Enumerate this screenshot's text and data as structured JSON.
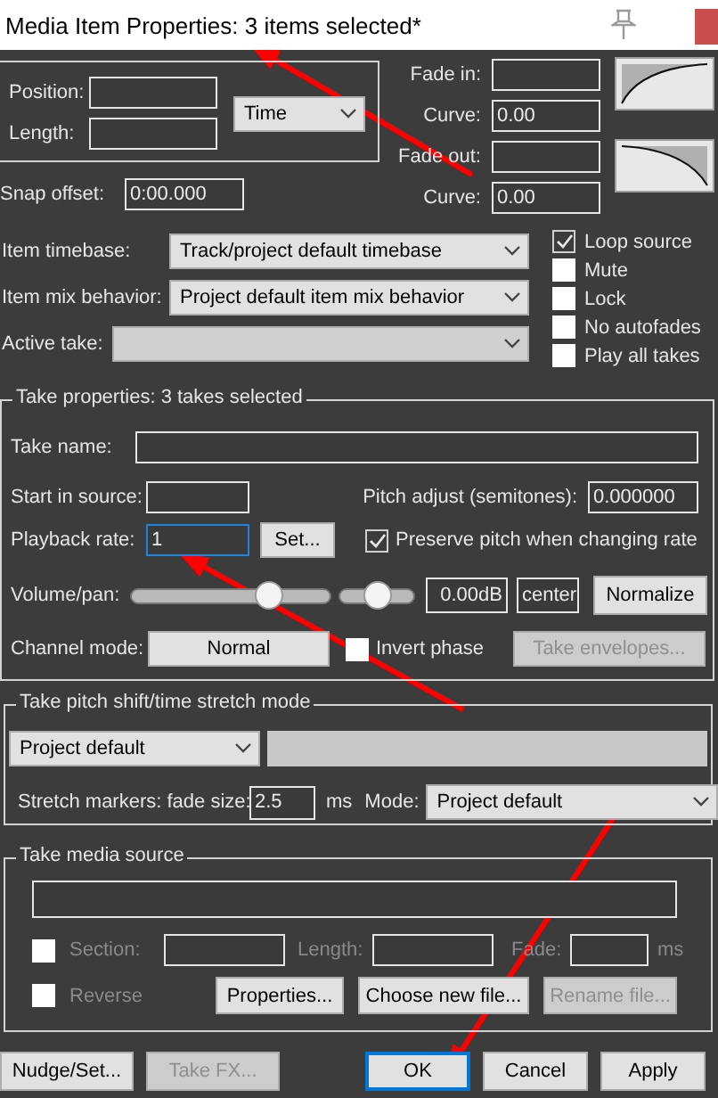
{
  "window": {
    "title": "Media Item Properties:  3 items selected*"
  },
  "position": {
    "label": "Position:"
  },
  "length": {
    "label": "Length:"
  },
  "time_format": {
    "value": "Time"
  },
  "fades": [
    {
      "kind": "in",
      "label": "Fade in:",
      "curve_label": "Curve:",
      "curve": "0.00"
    },
    {
      "kind": "out",
      "label": "Fade out:",
      "curve_label": "Curve:",
      "curve": "0.00"
    }
  ],
  "snap_offset": {
    "label": "Snap offset:",
    "value": "0:00.000"
  },
  "item_settings": [
    {
      "label": "Item timebase:",
      "value": "Track/project default timebase",
      "disabled": false
    },
    {
      "label": "Item mix behavior:",
      "value": "Project default item mix behavior",
      "disabled": false
    },
    {
      "label": "Active take:",
      "disabled": true
    }
  ],
  "item_options": [
    {
      "label": "Loop source",
      "checked": true
    },
    {
      "label": "Mute",
      "checked": false
    },
    {
      "label": "Lock",
      "checked": false
    },
    {
      "label": "No autofades",
      "checked": false
    },
    {
      "label": "Play all takes",
      "checked": false
    }
  ],
  "take_properties": {
    "title": "Take properties:  3 takes selected",
    "take_name_label": "Take name:",
    "start_label": "Start in source:",
    "pitch_adjust": {
      "label": "Pitch adjust (semitones):",
      "value": "0.000000"
    },
    "playback_rate": {
      "label": "Playback rate:",
      "value": "1",
      "focused": true
    },
    "set_button": "Set...",
    "preserve_pitch": {
      "label": "Preserve pitch when changing rate",
      "checked": true
    },
    "volume_pan_label": "Volume/pan:",
    "volume": {
      "level": 0.69,
      "reading": "0.00dB"
    },
    "pan": {
      "level": 0.5,
      "reading": "center"
    },
    "normalize_button": "Normalize",
    "channel_mode": {
      "label": "Channel mode:",
      "value": "Normal"
    },
    "invert_phase": {
      "label": "Invert phase",
      "checked": false
    },
    "take_envelopes": {
      "label": "Take envelopes...",
      "disabled": true
    }
  },
  "pitch_shift": {
    "title": "Take pitch shift/time stretch mode",
    "mode": "Project default",
    "fade_size_label": "Stretch markers: fade size:",
    "fade_size": "2.5",
    "unit": "ms",
    "mode_label": "Mode:",
    "stretch_mode": "Project default"
  },
  "media_source": {
    "title": "Take media source",
    "section": {
      "label": "Section:",
      "checked": false,
      "disabled": true
    },
    "length_label": "Length:",
    "fade_label": "Fade:",
    "unit": "ms",
    "reverse": {
      "label": "Reverse",
      "checked": false,
      "disabled": true
    },
    "buttons": [
      {
        "label": "Properties...",
        "disabled": false
      },
      {
        "label": "Choose new file...",
        "disabled": false
      },
      {
        "label": "Rename file...",
        "disabled": true
      }
    ]
  },
  "footer": {
    "left": [
      {
        "label": "Nudge/Set...",
        "disabled": false,
        "focused": false
      },
      {
        "label": "Take FX...",
        "disabled": true,
        "focused": false
      }
    ],
    "right": [
      {
        "label": "OK",
        "disabled": false,
        "focused": true
      },
      {
        "label": "Cancel",
        "disabled": false,
        "focused": false
      },
      {
        "label": "Apply",
        "disabled": false,
        "focused": false
      }
    ]
  }
}
